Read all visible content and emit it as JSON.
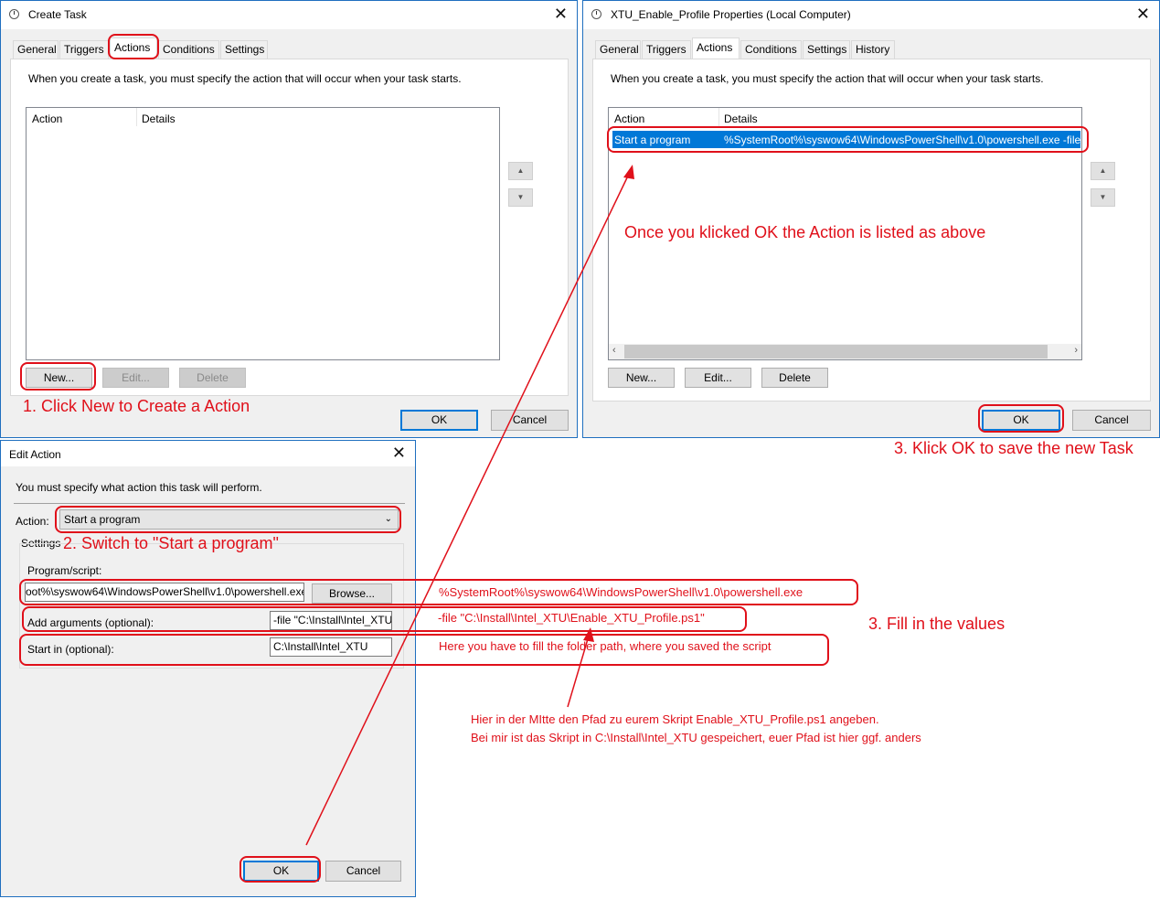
{
  "create_task": {
    "title": "Create Task",
    "tabs": [
      "General",
      "Triggers",
      "Actions",
      "Conditions",
      "Settings"
    ],
    "intro": "When you create a task, you must specify the action that will occur when your task starts.",
    "columns": [
      "Action",
      "Details"
    ],
    "new_label": "New...",
    "edit_label": "Edit...",
    "delete_label": "Delete",
    "ok_label": "OK",
    "cancel_label": "Cancel"
  },
  "props": {
    "title": "XTU_Enable_Profile Properties (Local Computer)",
    "tabs": [
      "General",
      "Triggers",
      "Actions",
      "Conditions",
      "Settings",
      "History"
    ],
    "intro": "When you create a task, you must specify the action that will occur when your task starts.",
    "columns": [
      "Action",
      "Details"
    ],
    "row": {
      "action": "Start a program",
      "details": "%SystemRoot%\\syswow64\\WindowsPowerShell\\v1.0\\powershell.exe -file \""
    },
    "new_label": "New...",
    "edit_label": "Edit...",
    "delete_label": "Delete",
    "ok_label": "OK",
    "cancel_label": "Cancel"
  },
  "edit_action": {
    "title": "Edit Action",
    "intro": "You must specify what action this task will perform.",
    "action_label": "Action:",
    "action_value": "Start a program",
    "settings_label": "Settings",
    "program_label": "Program/script:",
    "program_value": "oot%\\syswow64\\WindowsPowerShell\\v1.0\\powershell.exe",
    "browse_label": "Browse...",
    "args_label": "Add arguments (optional):",
    "args_value": "-file \"C:\\Install\\Intel_XTU",
    "start_label": "Start in (optional):",
    "start_value": "C:\\Install\\Intel_XTU",
    "ok_label": "OK",
    "cancel_label": "Cancel"
  },
  "annotations": {
    "step1": "1. Click New to Create a Action",
    "step2": "2. Switch to \"Start a program\"",
    "step3_fill": "3. Fill in the values",
    "step3_ok": "3. Klick OK to save the new Task",
    "listed": "Once you klicked OK the Action is listed as above",
    "path_value": "%SystemRoot%\\syswow64\\WindowsPowerShell\\v1.0\\powershell.exe",
    "args_value": "-file \"C:\\Install\\Intel_XTU\\Enable_XTU_Profile.ps1\"",
    "folder_hint": "Here you have to fill the folder path, where you saved the script",
    "german_1": "Hier in der MItte den Pfad zu eurem Skript Enable_XTU_Profile.ps1 angeben.",
    "german_2": "Bei mir ist das Skript in C:\\Install\\Intel_XTU gespeichert, euer Pfad ist hier ggf. anders"
  },
  "colors": {
    "annotation": "#e0101a",
    "window_border": "#1f6fbf",
    "selection": "#0078d7"
  }
}
